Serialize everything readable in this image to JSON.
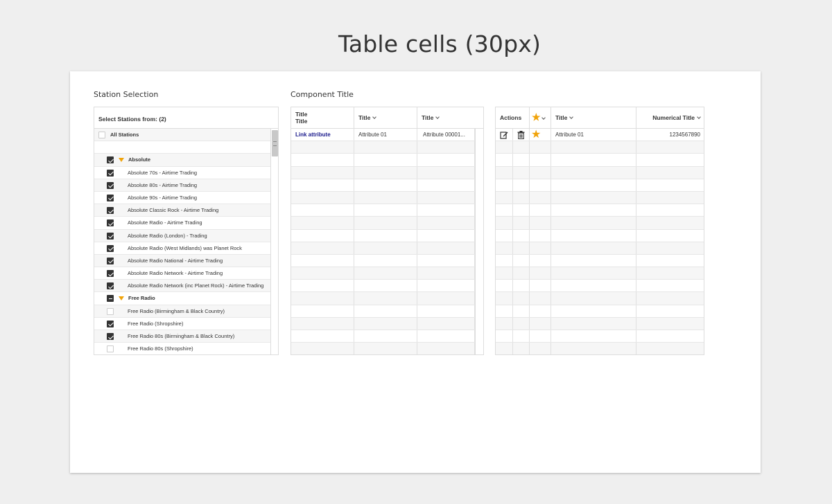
{
  "page": {
    "title": "Table cells (30px)"
  },
  "station_panel": {
    "label": "Station Selection",
    "header": "Select Stations from: (2)",
    "rows": [
      {
        "label": "All Stations",
        "state": "unchecked",
        "kind": "all"
      },
      {
        "label": "",
        "state": "none",
        "kind": "blank"
      },
      {
        "label": "Absolute",
        "state": "checked",
        "kind": "group"
      },
      {
        "label": "Absolute 70s - Airtime Trading",
        "state": "checked",
        "kind": "item"
      },
      {
        "label": "Absolute 80s - Airtime Trading",
        "state": "checked",
        "kind": "item"
      },
      {
        "label": "Absolute 90s - Airtime Trading",
        "state": "checked",
        "kind": "item"
      },
      {
        "label": "Absolute Classic Rock - Airtime Trading",
        "state": "checked",
        "kind": "item"
      },
      {
        "label": "Absolute Radio - Airtime Trading",
        "state": "checked",
        "kind": "item"
      },
      {
        "label": "Absolute Radio (London) - Trading",
        "state": "checked",
        "kind": "item"
      },
      {
        "label": "Absolute Radio (West Midlands) was Planet Rock",
        "state": "checked",
        "kind": "item"
      },
      {
        "label": "Absolute Radio National - Airtime Trading",
        "state": "checked",
        "kind": "item"
      },
      {
        "label": "Absolute Radio Network - Airtime Trading",
        "state": "checked",
        "kind": "item"
      },
      {
        "label": "Absolute Radio Network (inc Planet Rock) - Airtime Trading",
        "state": "checked",
        "kind": "item"
      },
      {
        "label": "Free Radio",
        "state": "partial",
        "kind": "group"
      },
      {
        "label": "Free Radio (Birmingham & Black Country)",
        "state": "unchecked",
        "kind": "item"
      },
      {
        "label": "Free Radio (Shropshire)",
        "state": "checked",
        "kind": "item"
      },
      {
        "label": "Free Radio 80s (Birmingham & Black Country)",
        "state": "checked",
        "kind": "item"
      },
      {
        "label": "Free Radio 80s (Shropshire)",
        "state": "unchecked",
        "kind": "item"
      }
    ]
  },
  "component_table": {
    "label": "Component Title",
    "columns": [
      {
        "line1": "Title",
        "line2": "Title",
        "sortable": false
      },
      {
        "line1": "Title",
        "line2": "",
        "sortable": true
      },
      {
        "line1": "Title",
        "line2": "",
        "sortable": true
      }
    ],
    "first_row": [
      "Link attribute",
      "Attribute 01",
      "Attribute 00001..."
    ],
    "row_count": 18
  },
  "action_table": {
    "columns": {
      "actions": "Actions",
      "title": "Title",
      "numerical": "Numerical Title"
    },
    "first_row": {
      "title": "Attribute 01",
      "number": "1234567890",
      "starred": true
    },
    "icons": {
      "edit": "edit-icon",
      "delete": "trash-icon",
      "favorite": "star-icon"
    },
    "row_count": 18
  },
  "colors": {
    "accent": "#f0a30a",
    "link": "#1a1a8c",
    "check": "#333333"
  }
}
